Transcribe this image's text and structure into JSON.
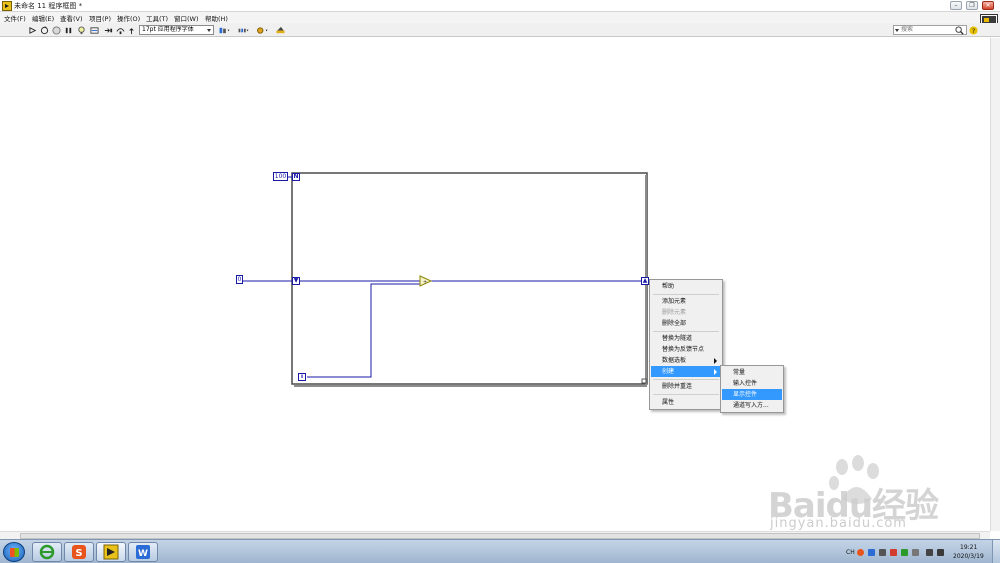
{
  "window": {
    "title": "未命名 11 程序框图 *",
    "controls": [
      "minimize",
      "restore",
      "close"
    ]
  },
  "menubar": {
    "items": [
      "文件(F)",
      "编辑(E)",
      "查看(V)",
      "项目(P)",
      "操作(O)",
      "工具(T)",
      "窗口(W)",
      "帮助(H)"
    ]
  },
  "toolbar": {
    "font_select_value": "17pt 应用程序字体",
    "search_placeholder": "搜索",
    "icons": [
      "run-arrow-icon",
      "run-continuously-icon",
      "abort-icon",
      "pause-icon",
      "highlight-execution-icon",
      "retain-wire-values-icon",
      "step-into-icon",
      "step-over-icon",
      "step-out-icon",
      "align-objects-icon",
      "distribute-objects-icon",
      "reorder-icon",
      "cleanup-diagram-icon",
      "search-icon",
      "help-icon"
    ]
  },
  "diagram": {
    "count_constant": "100",
    "count_terminal": "N",
    "input_constant": "0",
    "iteration_terminal": "i",
    "shift_register_left": "▼",
    "shift_register_right": "▲",
    "add_function_symbol": "+"
  },
  "context_menu": {
    "items": [
      {
        "label": "帮助",
        "enabled": true
      },
      {
        "label": "添加元素",
        "enabled": true
      },
      {
        "label": "删除元素",
        "enabled": false
      },
      {
        "label": "删除全部",
        "enabled": true
      },
      {
        "label": "替换为隧道",
        "enabled": true
      },
      {
        "label": "替换为反馈节点",
        "enabled": true
      },
      {
        "label": "数据选板",
        "enabled": true,
        "submenu": true
      },
      {
        "label": "创建",
        "enabled": true,
        "submenu": true,
        "highlighted": true
      },
      {
        "label": "删除并重连",
        "enabled": true
      },
      {
        "label": "属性",
        "enabled": true
      }
    ]
  },
  "submenu": {
    "items": [
      {
        "label": "常量",
        "highlighted": false
      },
      {
        "label": "输入控件",
        "highlighted": false
      },
      {
        "label": "显示控件",
        "highlighted": true
      },
      {
        "label": "通道写入方...",
        "highlighted": false
      }
    ]
  },
  "taskbar": {
    "apps": [
      "ie-browser",
      "sogou-input",
      "labview",
      "wps-office"
    ],
    "tray": {
      "lang": "CH",
      "time": "19:21",
      "date": "2020/3/19"
    }
  },
  "watermark": {
    "brand": "Baidu经验",
    "url": "jingyan.baidu.com"
  },
  "colors": {
    "wire_blue": "#1a1aa8",
    "menu_highlight": "#3399ff",
    "taskbar": "#b3c7de"
  }
}
